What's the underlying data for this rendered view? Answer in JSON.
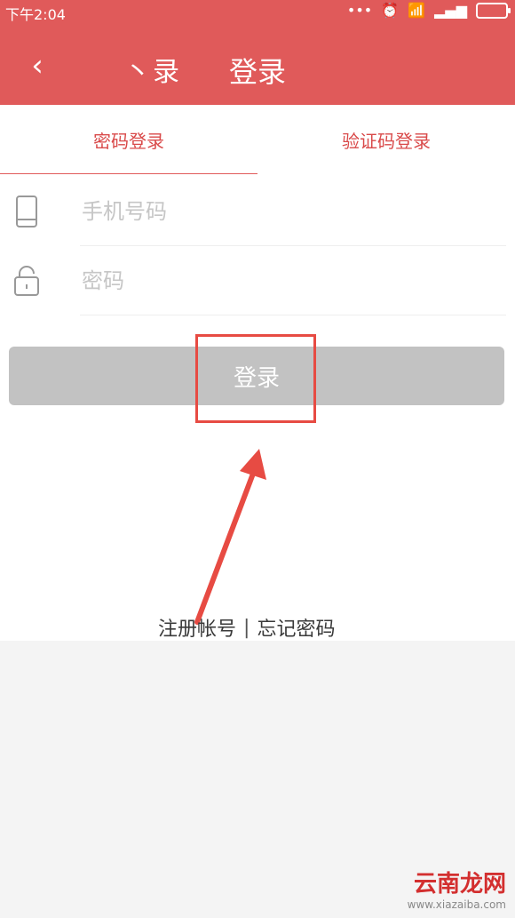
{
  "status_bar": {
    "time": "下午2:04",
    "icons": [
      "more-icon",
      "alarm-icon",
      "wifi-icon",
      "signal-icon",
      "battery-icon"
    ]
  },
  "toolbar": {
    "back_icon": "chevron-left-icon",
    "hint_text": "丶录",
    "title": "登录"
  },
  "tabs": [
    {
      "label": "密码登录",
      "active": true
    },
    {
      "label": "验证码登录",
      "active": false
    }
  ],
  "form": {
    "phone_placeholder": "手机号码",
    "password_placeholder": "密码"
  },
  "login_button_label": "登录",
  "footer": {
    "register_link": "注册帐号",
    "separator": "|",
    "forgot_link": "忘记密码"
  },
  "watermark": {
    "main": "云南龙网",
    "sub": "www.xiazaiba.com"
  },
  "colors": {
    "brand": "#e05a5a",
    "accent": "#d94a4a",
    "button_disabled": "#c2c2c2",
    "highlight": "#e74b43"
  }
}
